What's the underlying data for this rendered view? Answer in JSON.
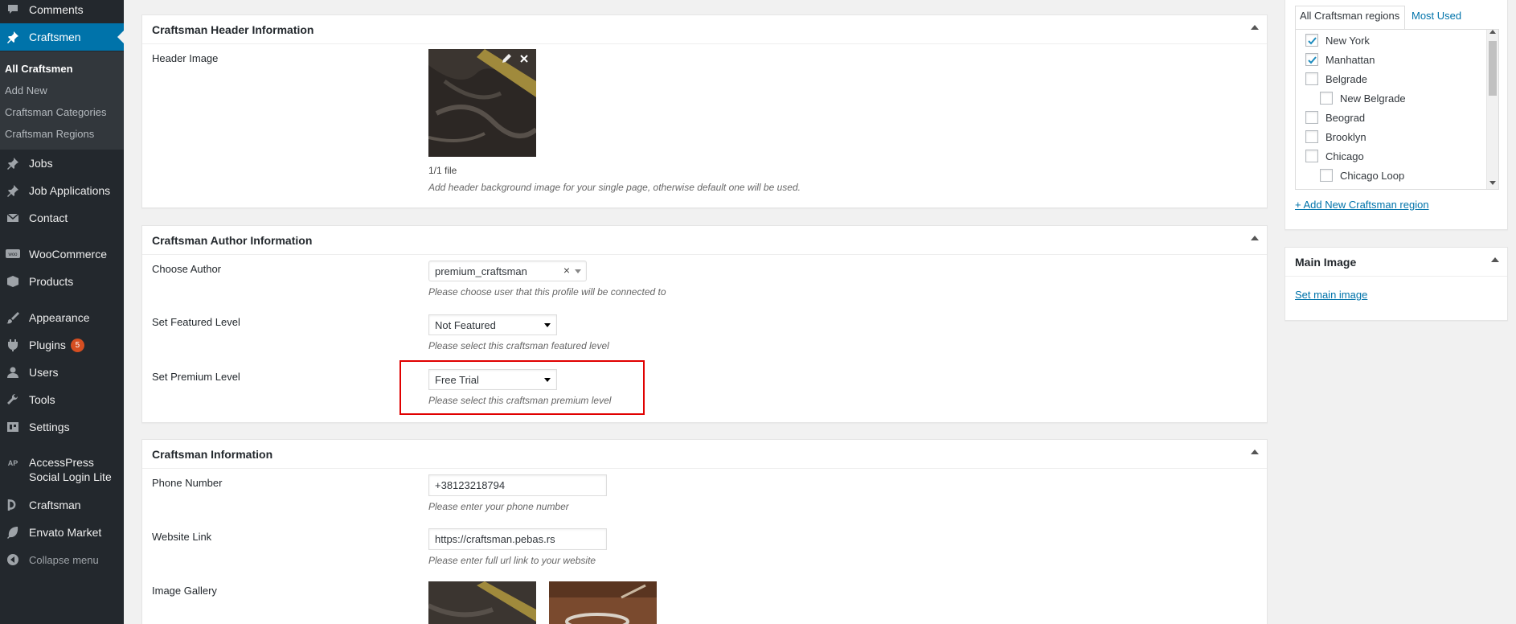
{
  "sidebar": {
    "items": [
      {
        "label": "Comments",
        "icon": "comments-icon"
      },
      {
        "label": "Craftsmen",
        "icon": "pushpin-icon"
      },
      {
        "label": "Jobs",
        "icon": "pushpin-icon"
      },
      {
        "label": "Job Applications",
        "icon": "pushpin-icon"
      },
      {
        "label": "Contact",
        "icon": "mail-icon"
      },
      {
        "label": "WooCommerce",
        "icon": "woocommerce-icon"
      },
      {
        "label": "Products",
        "icon": "box-icon"
      },
      {
        "label": "Appearance",
        "icon": "brush-icon"
      },
      {
        "label": "Plugins",
        "icon": "plugin-icon",
        "badge": "5"
      },
      {
        "label": "Users",
        "icon": "users-icon"
      },
      {
        "label": "Tools",
        "icon": "wrench-icon"
      },
      {
        "label": "Settings",
        "icon": "settings-icon"
      },
      {
        "label": "AccessPress Social Login Lite",
        "icon": "ap-icon",
        "icon_text": "AP"
      },
      {
        "label": "Craftsman",
        "icon": "craftsman-logo-icon"
      },
      {
        "label": "Envato Market",
        "icon": "leaf-icon"
      },
      {
        "label": "Collapse menu",
        "icon": "collapse-icon"
      }
    ],
    "submenu": [
      "All Craftsmen",
      "Add New",
      "Craftsman Categories",
      "Craftsman Regions"
    ]
  },
  "header_box": {
    "title": "Craftsman Header Information",
    "field_label": "Header Image",
    "file_count": "1/1 file",
    "description": "Add header background image for your single page, otherwise default one will be used."
  },
  "author_box": {
    "title": "Craftsman Author Information",
    "author_label": "Choose Author",
    "author_value": "premium_craftsman",
    "author_desc": "Please choose user that this profile will be connected to",
    "featured_label": "Set Featured Level",
    "featured_value": "Not Featured",
    "featured_desc": "Please select this craftsman featured level",
    "premium_label": "Set Premium Level",
    "premium_value": "Free Trial",
    "premium_desc": "Please select this craftsman premium level",
    "highlight_color": "#e00000"
  },
  "info_box": {
    "title": "Craftsman Information",
    "phone_label": "Phone Number",
    "phone_value": "+38123218794",
    "phone_desc": "Please enter your phone number",
    "website_label": "Website Link",
    "website_value": "https://craftsman.pebas.rs",
    "website_desc": "Please enter full url link to your website",
    "gallery_label": "Image Gallery"
  },
  "regions_box": {
    "tabs": [
      "All Craftsman regions",
      "Most Used"
    ],
    "regions": [
      {
        "label": "New York",
        "checked": true,
        "child": false
      },
      {
        "label": "Manhattan",
        "checked": true,
        "child": false
      },
      {
        "label": "Belgrade",
        "checked": false,
        "child": false
      },
      {
        "label": "New Belgrade",
        "checked": false,
        "child": true
      },
      {
        "label": "Beograd",
        "checked": false,
        "child": false
      },
      {
        "label": "Brooklyn",
        "checked": false,
        "child": false
      },
      {
        "label": "Chicago",
        "checked": false,
        "child": false
      },
      {
        "label": "Chicago Loop",
        "checked": false,
        "child": true
      }
    ],
    "add_link": "+ Add New Craftsman region"
  },
  "main_image_box": {
    "title": "Main Image",
    "link": "Set main image"
  },
  "colors": {
    "sidebar_bg": "#23282d",
    "active_bg": "#0073aa",
    "link": "#0073aa"
  }
}
